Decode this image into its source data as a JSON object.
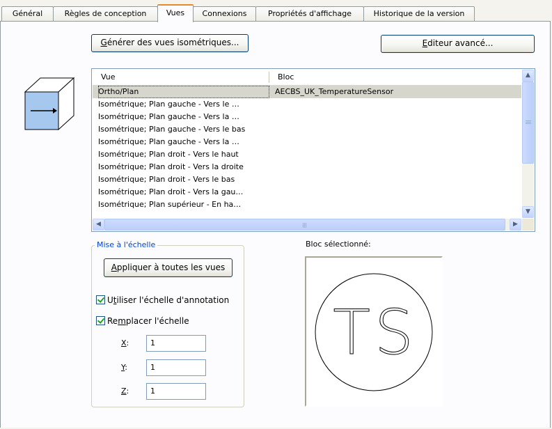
{
  "tabs": [
    {
      "label": "Général"
    },
    {
      "label": "Règles de conception"
    },
    {
      "label": "Vues"
    },
    {
      "label": "Connexions"
    },
    {
      "label": "Propriétés d'affichage"
    },
    {
      "label": "Historique de la version"
    }
  ],
  "active_tab": "Vues",
  "buttons": {
    "generate_iso_pre": "",
    "generate_iso_key": "G",
    "generate_iso_post": "énérer des vues isométriques...",
    "advanced_editor_pre": "",
    "advanced_editor_key": "E",
    "advanced_editor_post": "diteur avancé...",
    "apply_all_pre": "",
    "apply_all_key": "A",
    "apply_all_post": "ppliquer à toutes les vues"
  },
  "views_list": {
    "columns": [
      "Vue",
      "Bloc"
    ],
    "rows": [
      {
        "view": "Ortho/Plan",
        "block": "AECBS_UK_TemperatureSensor",
        "selected": true
      },
      {
        "view": "Isométrique; Plan gauche - Vers le …",
        "block": ""
      },
      {
        "view": "Isométrique; Plan gauche - Vers la …",
        "block": ""
      },
      {
        "view": "Isométrique; Plan gauche - Vers le bas",
        "block": ""
      },
      {
        "view": "Isométrique; Plan gauche - Vers la …",
        "block": ""
      },
      {
        "view": "Isométrique; Plan droit - Vers le haut",
        "block": ""
      },
      {
        "view": "Isométrique; Plan droit - Vers la droite",
        "block": ""
      },
      {
        "view": "Isométrique; Plan droit - Vers le bas",
        "block": ""
      },
      {
        "view": "Isométrique; Plan droit - Vers la gau…",
        "block": ""
      },
      {
        "view": "Isométrique; Plan supérieur - En ha…",
        "block": ""
      }
    ]
  },
  "scale_group": {
    "legend": "Mise à l'échelle",
    "use_annotation_scale": {
      "pre": "U",
      "key": "t",
      "post": "iliser l'échelle d'annotation",
      "checked": true
    },
    "override_scale": {
      "pre": "Re",
      "key": "m",
      "post": "placer l'échelle",
      "checked": true
    },
    "fields": [
      {
        "key": "X",
        "suffix": ":",
        "value": "1"
      },
      {
        "key": "Y",
        "suffix": ":",
        "value": "1"
      },
      {
        "key": "Z",
        "suffix": ":",
        "value": "1"
      }
    ]
  },
  "preview": {
    "label": "Bloc sélectionné:",
    "block_text": "TS"
  },
  "colors": {
    "tab_active_accent": "#e68b2c",
    "selection_bg": "#d7d6cc",
    "groupbox_legend": "#0046d5",
    "check_green": "#21a121",
    "icon_face": "#a6c8ef"
  },
  "icons": [
    "iso-view-cube-icon",
    "scroll-up-icon",
    "scroll-down-icon",
    "scroll-left-icon",
    "scroll-right-icon",
    "checkmark-icon"
  ]
}
